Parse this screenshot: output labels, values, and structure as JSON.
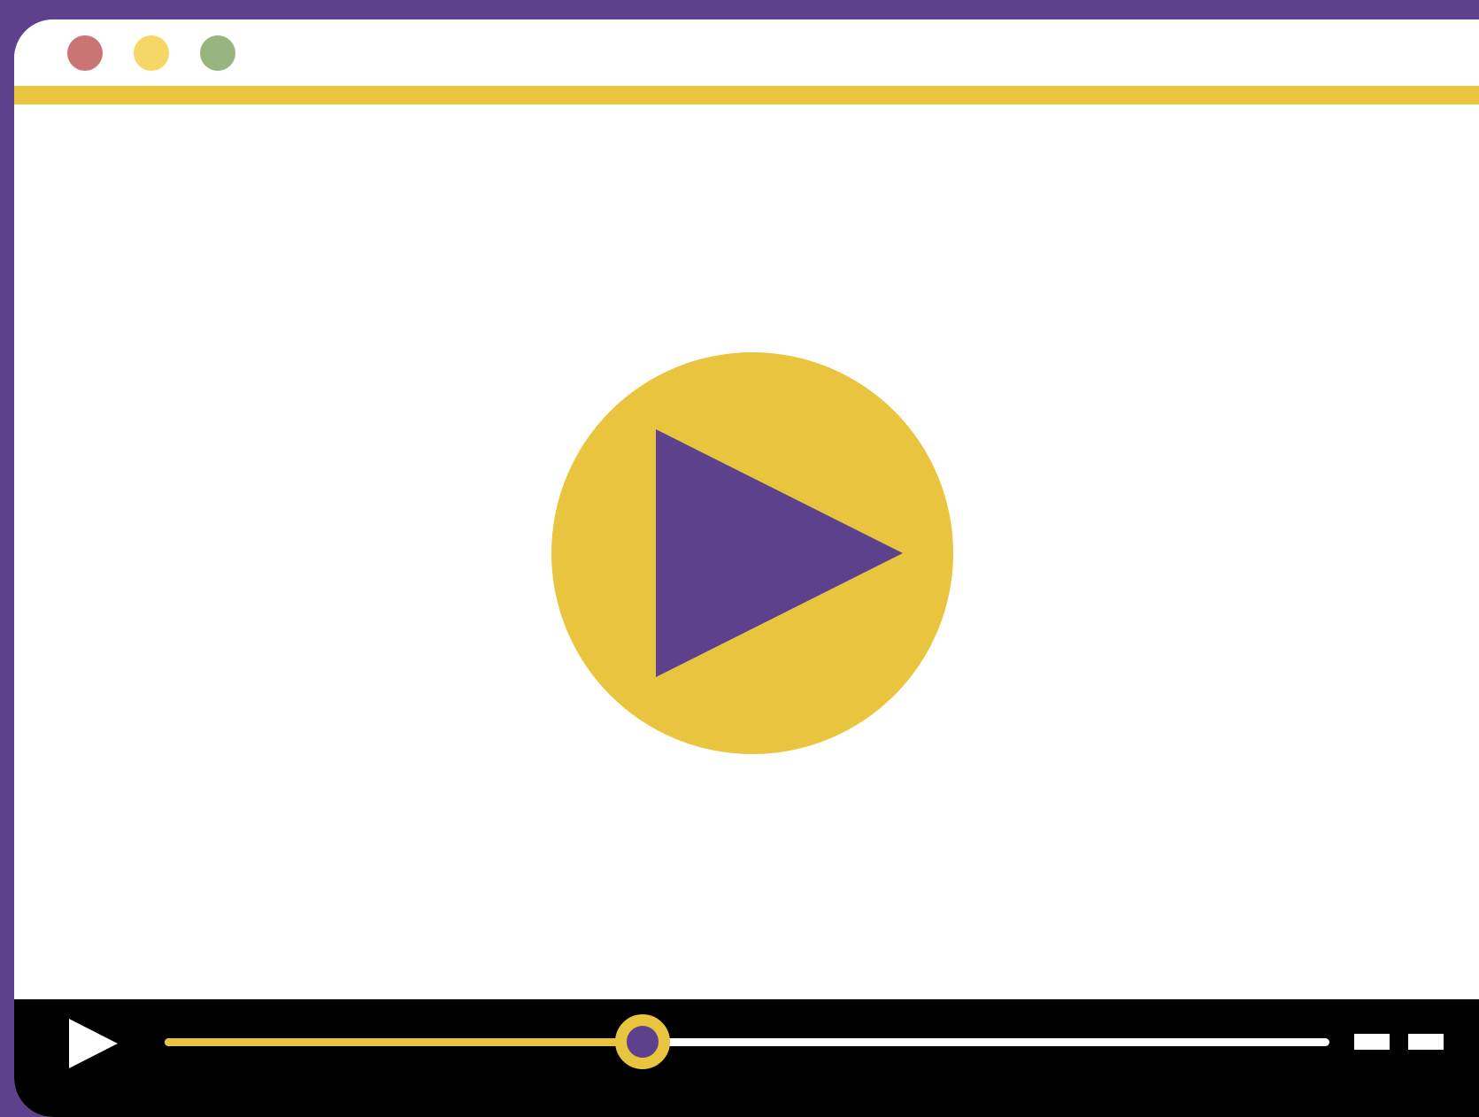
{
  "theme": {
    "frame_color": "#5e418c",
    "accent_color": "#e9c53f",
    "window_background": "#ffffff",
    "control_bar_color": "#000000"
  },
  "window_controls": [
    {
      "name": "close",
      "color": "#cb7474"
    },
    {
      "name": "minimize",
      "color": "#f5d667"
    },
    {
      "name": "maximize",
      "color": "#99b57f"
    }
  ],
  "player": {
    "center_button_icon": "play-icon",
    "center_button_fill": "#e9c53f",
    "center_icon_color": "#5e418c",
    "controls": {
      "play_icon": "play-icon",
      "progress_fraction": 0.41,
      "right_buttons": [
        "dash-icon",
        "dash-icon"
      ]
    }
  }
}
